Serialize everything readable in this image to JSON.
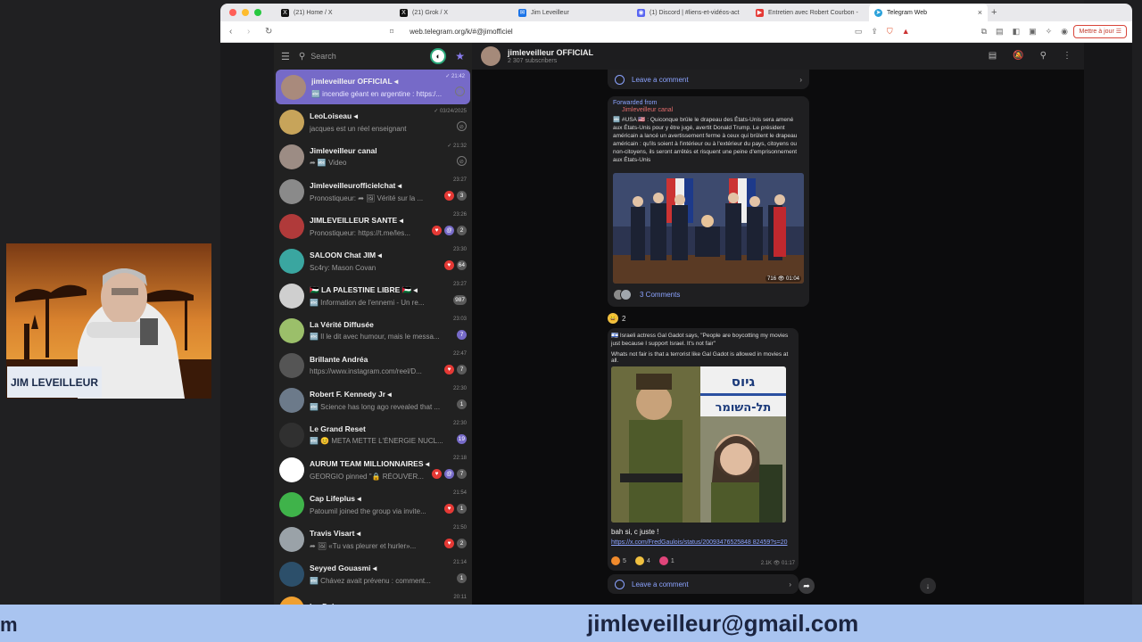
{
  "browser": {
    "tabs": [
      {
        "label": "(21) Home / X",
        "icon": "x-logo",
        "color": "#111111",
        "glyph": "X"
      },
      {
        "label": "(21) Grok / X",
        "icon": "x-logo",
        "color": "#111111",
        "glyph": "X"
      },
      {
        "label": "Jim Leveilleur",
        "icon": "mail-icon",
        "color": "#1a73e8",
        "glyph": "✉"
      },
      {
        "label": "(1) Discord | #liens-et-vidéos-act",
        "icon": "discord-logo",
        "color": "#5865f2",
        "glyph": "◉"
      },
      {
        "label": "Entretien avec Robert Courbon -",
        "icon": "youtube-logo",
        "color": "#e53935",
        "glyph": "▶"
      },
      {
        "label": "Telegram Web",
        "icon": "telegram-logo",
        "color": "#2aa1da",
        "glyph": "➤",
        "active": true,
        "close": "×"
      }
    ],
    "new_tab": "+",
    "url": "web.telegram.org/k/#@jimofficiel",
    "update_button": "Mettre à jour ☰"
  },
  "telegram": {
    "search_placeholder": "Search",
    "chats": [
      {
        "name": "jimleveilleur OFFICIAL ◂",
        "preview": "🔤 incendie géant en argentine : https:/...",
        "time": "✓ 21:42",
        "avatar_color": "#a98a7c",
        "selected": true,
        "badges": [
          {
            "type": "pin",
            "text": "⊘"
          }
        ]
      },
      {
        "name": "LeoLoiseau ◂",
        "preview": "jacques est un réel enseignant",
        "time": "✓ 03/24/2025",
        "avatar_color": "#c7a45a",
        "badges": [
          {
            "type": "pin",
            "text": "⊘"
          }
        ]
      },
      {
        "name": "Jimleveilleur canal",
        "preview": "➦ 🔤 Video",
        "time": "✓ 21:32",
        "avatar_color": "#9c8c84",
        "badges": [
          {
            "type": "pin",
            "text": "⊘"
          }
        ]
      },
      {
        "name": "Jimleveilleurofficielchat ◂",
        "preview": "Pronostiqueur: ➦ 🖼 Vérité sur la ...",
        "time": "23:27",
        "avatar_color": "#8a8a8a",
        "badges": [
          {
            "type": "heart",
            "text": "♥"
          },
          {
            "type": "count",
            "text": "3"
          }
        ]
      },
      {
        "name": "JIMLEVEILLEUR SANTE ◂",
        "preview": "Pronostiqueur: https://t.me/les...",
        "time": "23:26",
        "avatar_color": "#b03a3a",
        "badges": [
          {
            "type": "heart",
            "text": "♥"
          },
          {
            "type": "mention",
            "text": "@"
          },
          {
            "type": "count",
            "text": "2"
          }
        ]
      },
      {
        "name": "SALOON Chat JIM ◂",
        "preview": "Sc4ry: Mason Covan",
        "time": "23:30",
        "avatar_color": "#3aa6a0",
        "badges": [
          {
            "type": "heart",
            "text": "♥"
          },
          {
            "type": "count",
            "text": "64"
          }
        ]
      },
      {
        "name": "🇵🇸 LA PALESTINE LIBRE 🇵🇸 ◂",
        "preview": "🔤 Information de l'ennemi - Un re...",
        "time": "23:27",
        "avatar_color": "#cfcfcf",
        "badges": [
          {
            "type": "count",
            "text": "987"
          }
        ]
      },
      {
        "name": "La Vérité Diffusée",
        "preview": "🔤 Il le dit avec humour, mais le messa...",
        "time": "23:03",
        "avatar_color": "#9bbf6a",
        "badges": [
          {
            "type": "count-purple",
            "text": "7"
          }
        ]
      },
      {
        "name": "Brillante Andréa",
        "preview": "https://www.instagram.com/reel/D...",
        "time": "22:47",
        "avatar_color": "#555555",
        "badges": [
          {
            "type": "heart",
            "text": "♥"
          },
          {
            "type": "count",
            "text": "7"
          }
        ]
      },
      {
        "name": "Robert F. Kennedy Jr ◂",
        "preview": "🔤 Science has long ago revealed that ...",
        "time": "22:30",
        "avatar_color": "#6c7a8a",
        "badges": [
          {
            "type": "count",
            "text": "1"
          }
        ]
      },
      {
        "name": "Le Grand Reset",
        "preview": "🔤 😊 META METTE L'ÉNERGIE NUCL...",
        "time": "22:30",
        "avatar_color": "#303030",
        "badges": [
          {
            "type": "count-purple",
            "text": "19"
          }
        ]
      },
      {
        "name": "AURUM TEAM MILLIONNAIRES ◂",
        "preview": "GEORGIO pinned \"🔒 RÉOUVER...",
        "time": "22:18",
        "avatar_color": "#ffffff",
        "badges": [
          {
            "type": "heart",
            "text": "♥"
          },
          {
            "type": "mention",
            "text": "@"
          },
          {
            "type": "count",
            "text": "7"
          }
        ]
      },
      {
        "name": "Cap Lifeplus ◂",
        "preview": "Patoumil joined the group via invite...",
        "time": "21:54",
        "avatar_color": "#3fb34a",
        "badges": [
          {
            "type": "heart",
            "text": "♥"
          },
          {
            "type": "count",
            "text": "1"
          }
        ]
      },
      {
        "name": "Travis Visart ◂",
        "preview": "➦ 🖼 «Tu vas pleurer et hurler»...",
        "time": "21:50",
        "avatar_color": "#9aa2a8",
        "badges": [
          {
            "type": "heart",
            "text": "♥"
          },
          {
            "type": "count",
            "text": "2"
          }
        ]
      },
      {
        "name": "Seyyed Gouasmi ◂",
        "preview": "🔤 Chávez avait prévenu : comment...",
        "time": "21:14",
        "avatar_color": "#2c4f6a",
        "badges": [
          {
            "type": "count",
            "text": "1"
          }
        ]
      },
      {
        "name": "Isa Del ◂",
        "preview": "",
        "time": "20:11",
        "avatar_color": "#f0a030",
        "initials": "ID",
        "badges": [
          {
            "type": "count",
            "text": "1"
          }
        ]
      }
    ],
    "channel": {
      "title": "jimleveilleur OFFICIAL",
      "subscribers": "2 307 subscribers"
    },
    "top_comment_bar": "Leave a comment",
    "post1": {
      "forwarded_label": "Forwarded from",
      "forwarded_from": "Jimleveilleur canal",
      "text": "🔤 #USA 🇺🇸 : Quiconque brûle le drapeau des États-Unis sera amené aux États-Unis pour y être jugé, avertit Donald Trump. Le président américain a lancé un avertissement ferme à ceux qui brûlent le drapeau américain : qu'ils soient à l'intérieur ou à l'extérieur du pays, citoyens ou non-citoyens, ils seront arrêtés et risquent une peine d'emprisonnement aux États-Unis",
      "photo_meta": "716 👁 01:04",
      "comments": "3 Comments"
    },
    "reaction1": {
      "emoji": "😄",
      "count": "2"
    },
    "post2": {
      "text": "🇮🇱 Israeli actress Gal Gadot says, \"People are boycotting my movies just because I support Israel. It's not fair\"",
      "text2": "Whats not fair is that a terrorist like Gal Gadot is allowed in movies at all.",
      "photo_sign_top": "גיוס",
      "photo_sign_bottom": "תל-השומר",
      "caption": "bah si, c juste !",
      "link": "https://x.com/FredGaulois/status/20093476525848 82459?s=20",
      "reactions": [
        {
          "emoji": "🔥",
          "count": "5",
          "color": "#f08a2c"
        },
        {
          "emoji": "😄",
          "count": "4",
          "color": "#f0c040"
        },
        {
          "emoji": "💘",
          "count": "1",
          "color": "#e0457a"
        }
      ],
      "meta": "2.1K 👁 01:17"
    },
    "bottom_comment_bar": "Leave a comment"
  },
  "webcam": {
    "name_tag": "JIM LEVEILLEUR"
  },
  "lower_third": {
    "left_fragment": "m",
    "email": "jimleveilleur@gmail.com"
  }
}
